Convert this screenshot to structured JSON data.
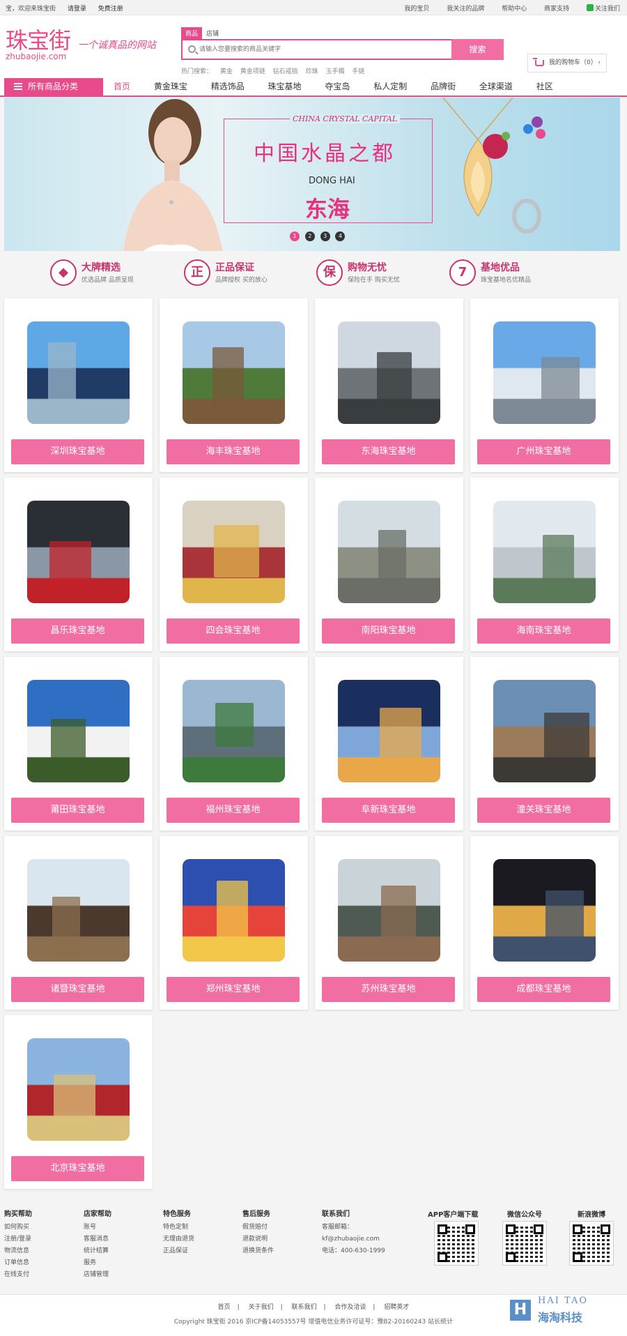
{
  "topbar": {
    "welcome": "宝，欢迎来珠宝街",
    "login": "请登录",
    "register": "免费注册",
    "links": [
      "我的宝贝",
      "我关注的品牌",
      "帮助中心",
      "商家支持",
      "关注我们"
    ]
  },
  "header": {
    "logo_cn": "珠宝街",
    "logo_en": "zhubaojie.com",
    "slogan": "一个诚真品的网站",
    "search_tabs": [
      "商品",
      "店铺"
    ],
    "search_placeholder": "请输入您要搜索的商品关键字",
    "search_button": "搜索",
    "hot_label": "热门搜索：",
    "hot_terms": [
      "黄金",
      "黄金项链",
      "钻石戒指",
      "珍珠",
      "玉手镯",
      "手链"
    ],
    "cart_label": "我的购物车（0）",
    "cart_arrow": "›"
  },
  "nav": {
    "all_categories": "所有商品分类",
    "items": [
      "首页",
      "黄金珠宝",
      "精选饰品",
      "珠宝基地",
      "夺宝岛",
      "私人定制",
      "品牌街",
      "全球渠道",
      "社区"
    ]
  },
  "banner": {
    "en_top": "CHINA CRYSTAL CAPITAL",
    "cn_title": "中国水晶之都",
    "en_sub": "DONG HAI",
    "cn_sub": "东海",
    "pages": [
      "1",
      "2",
      "3",
      "4"
    ]
  },
  "features": [
    {
      "icon": "diamond-icon",
      "glyph": "◆",
      "title": "大牌精选",
      "sub": "优选品牌 品质呈现"
    },
    {
      "icon": "genuine-icon",
      "glyph": "正",
      "title": "正品保证",
      "sub": "品牌授权 买的放心"
    },
    {
      "icon": "insurance-icon",
      "glyph": "保",
      "title": "购物无忧",
      "sub": "保险在手 购买无忧"
    },
    {
      "icon": "seven-day-icon",
      "glyph": "7",
      "title": "基地优品",
      "sub": "珠宝基地名优精品"
    }
  ],
  "bases": [
    "深圳珠宝基地",
    "海丰珠宝基地",
    "东海珠宝基地",
    "广州珠宝基地",
    "昌乐珠宝基地",
    "四会珠宝基地",
    "南阳珠宝基地",
    "海南珠宝基地",
    "莆田珠宝基地",
    "福州珠宝基地",
    "阜新珠宝基地",
    "潼关珠宝基地",
    "诸暨珠宝基地",
    "郑州珠宝基地",
    "苏州珠宝基地",
    "成都珠宝基地",
    "北京珠宝基地"
  ],
  "footer": {
    "columns": [
      {
        "title": "购买帮助",
        "items": [
          "如何购买",
          "注册/登录",
          "物流信息",
          "订单信息",
          "在线支付"
        ]
      },
      {
        "title": "店家帮助",
        "items": [
          "账号",
          "客服消息",
          "统计结算",
          "服务",
          "店铺管理"
        ]
      },
      {
        "title": "特色服务",
        "items": [
          "特色定制",
          "无理由退货",
          "正品保证"
        ]
      },
      {
        "title": "售后服务",
        "items": [
          "假货赔付",
          "退款说明",
          "退换货条件"
        ]
      },
      {
        "title": "联系我们",
        "items": [
          "客服邮箱：",
          "kf@zhubaojie.com",
          "电话：400-630-1999"
        ]
      }
    ],
    "qr": [
      "APP客户端下载",
      "微信公众号",
      "新浪微博"
    ],
    "bottom_links": [
      "首页",
      "关于我们",
      "联系我们",
      "合作及洽谈",
      "招聘英才"
    ],
    "copyright": "Copyright 珠宝街 2016 京ICP备14053557号 增值电信业务许可证号：豫B2-20160243 站长统计",
    "brand_en": "HAI TAO",
    "brand_cn": "海淘科技"
  },
  "colors": {
    "accent": "#e84a8a",
    "button": "#f06ea1"
  }
}
